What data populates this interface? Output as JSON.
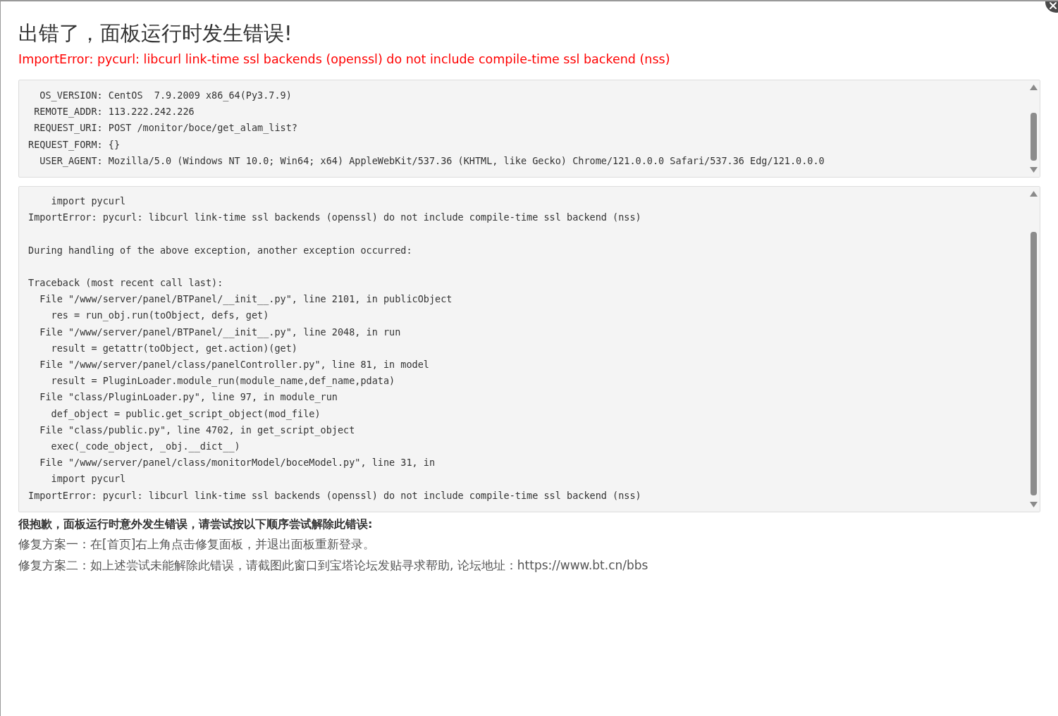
{
  "title": "出错了，面板运行时发生错误!",
  "error_message": "ImportError: pycurl: libcurl link-time ssl backends (openssl) do not include compile-time ssl backend (nss)",
  "info_lines": [
    "  OS_VERSION: CentOS  7.9.2009 x86_64(Py3.7.9)",
    " REMOTE_ADDR: 113.222.242.226",
    " REQUEST_URI: POST /monitor/boce/get_alam_list?",
    "REQUEST_FORM: {}",
    "  USER_AGENT: Mozilla/5.0 (Windows NT 10.0; Win64; x64) AppleWebKit/537.36 (KHTML, like Gecko) Chrome/121.0.0.0 Safari/537.36 Edg/121.0.0.0"
  ],
  "traceback_blocks": [
    [
      "    import pycurl",
      "ImportError: pycurl: libcurl link-time ssl backends (openssl) do not include compile-time ssl backend (nss)"
    ],
    [
      "During handling of the above exception, another exception occurred:"
    ],
    [
      "Traceback (most recent call last):",
      "  File \"/www/server/panel/BTPanel/__init__.py\", line 2101, in publicObject",
      "    res = run_obj.run(toObject, defs, get)",
      "  File \"/www/server/panel/BTPanel/__init__.py\", line 2048, in run",
      "    result = getattr(toObject, get.action)(get)",
      "  File \"/www/server/panel/class/panelController.py\", line 81, in model",
      "    result = PluginLoader.module_run(module_name,def_name,pdata)",
      "  File \"class/PluginLoader.py\", line 97, in module_run",
      "    def_object = public.get_script_object(mod_file)",
      "  File \"class/public.py\", line 4702, in get_script_object",
      "    exec(_code_object, _obj.__dict__)",
      "  File \"/www/server/panel/class/monitorModel/boceModel.py\", line 31, in",
      "    import pycurl",
      "ImportError: pycurl: libcurl link-time ssl backends (openssl) do not include compile-time ssl backend (nss)"
    ]
  ],
  "help_heading": "很抱歉，面板运行时意外发生错误，请尝试按以下顺序尝试解除此错误:",
  "fixes": [
    "修复方案一：在[首页]右上角点击修复面板，并退出面板重新登录。",
    "修复方案二：如上述尝试未能解除此错误，请截图此窗口到宝塔论坛发贴寻求帮助, 论坛地址：https://www.bt.cn/bbs"
  ]
}
